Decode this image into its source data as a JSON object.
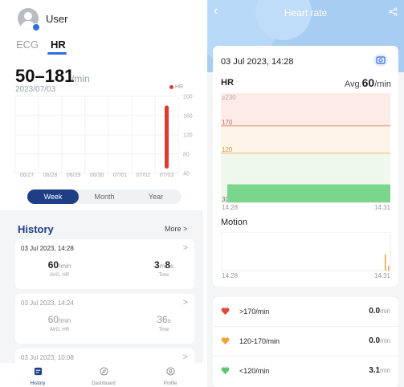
{
  "left": {
    "user": "User",
    "tabs": {
      "ecg": "ECG",
      "hr": "HR"
    },
    "range": "50–181",
    "range_unit": "/min",
    "date": "2023/07/03",
    "legend": "HR",
    "chart": {
      "y_ticks": [
        "200",
        "160",
        "120",
        "80",
        "40"
      ],
      "x_ticks": [
        "06/27",
        "06/28",
        "06/29",
        "06/30",
        "07/01",
        "07/02",
        "07/03"
      ],
      "bar_color": "#e03a2e"
    },
    "periods": [
      "Week",
      "Month",
      "Year"
    ],
    "history": {
      "title": "History",
      "more": "More",
      "chevron": ">",
      "items": [
        {
          "time": "03 Jul 2023, 14:28",
          "hr": "60",
          "hr_unit": "/min",
          "hr_label": "AVG. HR",
          "dur_a": "3",
          "dur_a_unit": "m",
          "dur_b": "8",
          "dur_b_unit": "s",
          "dur_label": "Time"
        },
        {
          "time": "03 Jul 2023, 14:24",
          "hr": "60",
          "hr_unit": "/min",
          "hr_label": "AVG. HR",
          "dur_a": "",
          "dur_a_unit": "",
          "dur_b": "36",
          "dur_b_unit": "s",
          "dur_label": "Time"
        },
        {
          "time": "03 Jul 2023, 10:08"
        }
      ]
    },
    "nav": [
      {
        "label": "History",
        "icon": "history-icon"
      },
      {
        "label": "Dashboard",
        "icon": "compass-icon"
      },
      {
        "label": "Profile",
        "icon": "profile-icon"
      }
    ]
  },
  "right": {
    "title": "Heart rate",
    "date": "03 Jul 2023, 14:28",
    "hr_title": "HR",
    "avg_label": "Avg.",
    "avg_value": "60",
    "avg_unit": "/min",
    "hr_chart": {
      "labels": [
        "≥230",
        "170",
        "120",
        "30"
      ],
      "t_start": "14:28",
      "t_end": "14:31",
      "zone_colors": [
        "#fdebe7",
        "#fdf3e7",
        "#eef8ec"
      ],
      "line_colors": [
        "#e9886f",
        "#efb46a"
      ],
      "bar_color": "#7ad68c"
    },
    "motion_title": "Motion",
    "motion_chart": {
      "t_start": "14:28",
      "t_end": "14:31",
      "spike_color": "#f0a040"
    },
    "zones": [
      {
        "label": ">170/min",
        "value": "0.0",
        "unit": "min",
        "color": "#e0483e"
      },
      {
        "label": "120-170/min",
        "value": "0.0",
        "unit": "min",
        "color": "#f2a33a"
      },
      {
        "label": "<120/min",
        "value": "3.1",
        "unit": "min",
        "color": "#5cc86c"
      }
    ]
  }
}
